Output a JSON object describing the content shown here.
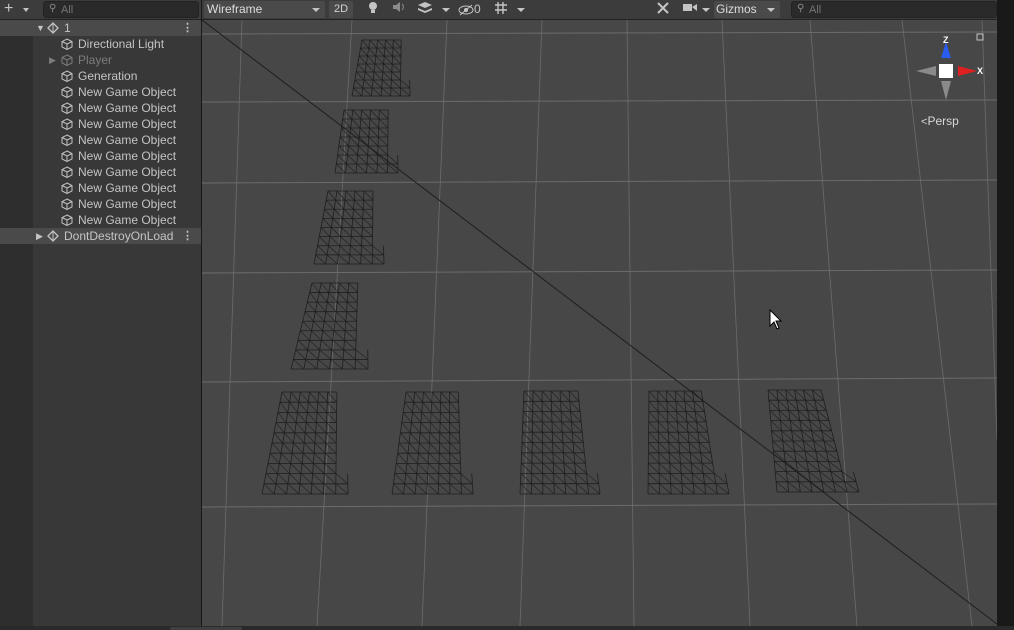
{
  "hierarchy": {
    "search_placeholder": "All",
    "scene_name": "1",
    "items": [
      {
        "label": "Directional Light",
        "dim": false,
        "has_children": false
      },
      {
        "label": "Player",
        "dim": true,
        "has_children": true
      },
      {
        "label": "Generation",
        "dim": false,
        "has_children": false
      },
      {
        "label": "New Game Object",
        "dim": false,
        "has_children": false
      },
      {
        "label": "New Game Object",
        "dim": false,
        "has_children": false
      },
      {
        "label": "New Game Object",
        "dim": false,
        "has_children": false
      },
      {
        "label": "New Game Object",
        "dim": false,
        "has_children": false
      },
      {
        "label": "New Game Object",
        "dim": false,
        "has_children": false
      },
      {
        "label": "New Game Object",
        "dim": false,
        "has_children": false
      },
      {
        "label": "New Game Object",
        "dim": false,
        "has_children": false
      },
      {
        "label": "New Game Object",
        "dim": false,
        "has_children": false
      },
      {
        "label": "New Game Object",
        "dim": false,
        "has_children": false
      }
    ],
    "dont_destroy_label": "DontDestroyOnLoad"
  },
  "scene_toolbar": {
    "draw_mode": "Wireframe",
    "btn_2d": "2D",
    "hidden_count": "0",
    "gizmos_label": "Gizmos",
    "search_placeholder": "All"
  },
  "scene_gizmo": {
    "axis_y": "Z",
    "axis_x": "X",
    "projection": "Persp"
  },
  "colors": {
    "axis_x": "#e02020",
    "axis_z": "#2a5cf0",
    "scene_bg": "#474747",
    "grid_line": "#8a8a8a"
  }
}
